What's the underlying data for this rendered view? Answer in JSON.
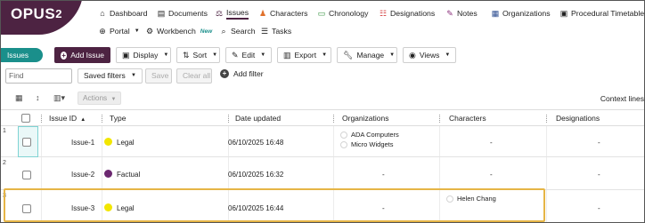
{
  "logo": {
    "text": "OPUS",
    "sup": "2"
  },
  "nav": {
    "row1": [
      {
        "icon": "⌂",
        "icon_name": "home-icon",
        "label": "Dashboard"
      },
      {
        "icon": "▤",
        "icon_name": "documents-icon",
        "label": "Documents"
      },
      {
        "icon": "⚖",
        "icon_name": "scales-icon",
        "label": "Issues",
        "active": true
      },
      {
        "icon": "♟",
        "icon_name": "characters-icon",
        "label": "Characters"
      },
      {
        "icon": "▭",
        "icon_name": "chronology-icon",
        "label": "Chronology"
      },
      {
        "icon": "☷",
        "icon_name": "designations-icon",
        "label": "Designations"
      },
      {
        "icon": "✎",
        "icon_name": "notes-icon",
        "label": "Notes"
      },
      {
        "icon": "▦",
        "icon_name": "organizations-icon",
        "label": "Organizations"
      },
      {
        "icon": "▣",
        "icon_name": "timetable-icon",
        "label": "Procedural Timetable"
      }
    ],
    "row2": [
      {
        "icon": "⊕",
        "icon_name": "globe-icon",
        "label": "Portal",
        "dropdown": true
      },
      {
        "icon": "⚙",
        "icon_name": "workbench-icon",
        "label": "Workbench",
        "tag": "New"
      },
      {
        "icon": "⌕",
        "icon_name": "search-icon",
        "label": "Search"
      },
      {
        "icon": "☰",
        "icon_name": "tasks-icon",
        "label": "Tasks"
      }
    ]
  },
  "toolbar": {
    "tab_label": "Issues",
    "add_issue": "Add Issue",
    "display": "Display",
    "sort": "Sort",
    "edit": "Edit",
    "export": "Export",
    "manage": "Manage",
    "views": "Views"
  },
  "filters": {
    "find_placeholder": "Find",
    "saved_filters": "Saved filters",
    "save": "Save",
    "clear_all": "Clear all",
    "add_filter": "Add filter"
  },
  "grid_toolbar": {
    "actions": "Actions",
    "context_lines": "Context lines"
  },
  "table": {
    "columns": {
      "issue_id": "Issue ID",
      "type": "Type",
      "date_updated": "Date updated",
      "organizations": "Organizations",
      "characters": "Characters",
      "designations": "Designations"
    },
    "rows": [
      {
        "num": "1",
        "id": "Issue-1",
        "type": "Legal",
        "type_color": "#f2e600",
        "date": "06/10/2025 16:48",
        "orgs": [
          "ADA Computers",
          "Micro Widgets"
        ],
        "characters_text": "-",
        "characters": [],
        "designations": "-"
      },
      {
        "num": "2",
        "id": "Issue-2",
        "type": "Factual",
        "type_color": "#6b2770",
        "date": "06/10/2025 16:32",
        "orgs_text": "-",
        "characters_text": "-",
        "characters": [],
        "designations": "-"
      },
      {
        "num": "3",
        "id": "Issue-3",
        "type": "Legal",
        "type_color": "#f2e600",
        "date": "06/10/2025 16:44",
        "orgs_text": "-",
        "characters": [
          "Helen Chang"
        ],
        "designations": "-"
      }
    ]
  }
}
